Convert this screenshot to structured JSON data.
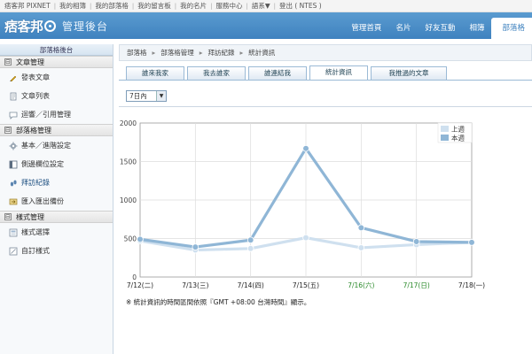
{
  "topbar": {
    "links": [
      "痞客邦 PIXNET",
      "我的相簿",
      "我的部落格",
      "我的留言板",
      "我的名片",
      "服務中心",
      "語系▼",
      "登出 ( NTES )"
    ]
  },
  "header": {
    "logo_text": "痞客邦",
    "subtitle": "管理後台",
    "nav": [
      "管理首頁",
      "名片",
      "好友互動",
      "相簿",
      "部落格"
    ]
  },
  "sidebar": {
    "title": "部落格後台",
    "sections": [
      {
        "toggle": "⊟",
        "label": "文章管理",
        "items": [
          {
            "label": "發表文章",
            "icon": "pencil-icon"
          },
          {
            "label": "文章列表",
            "icon": "document-list-icon"
          },
          {
            "label": "迴響／引用管理",
            "icon": "comment-icon"
          }
        ]
      },
      {
        "toggle": "⊟",
        "label": "部落格管理",
        "items": [
          {
            "label": "基本／進階設定",
            "icon": "gear-icon"
          },
          {
            "label": "側邊欄位設定",
            "icon": "layout-icon"
          },
          {
            "label": "拜訪紀錄",
            "icon": "footprint-icon"
          },
          {
            "label": "匯入匯出備份",
            "icon": "import-export-icon"
          }
        ]
      },
      {
        "toggle": "⊟",
        "label": "樣式管理",
        "items": [
          {
            "label": "樣式選擇",
            "icon": "template-icon"
          },
          {
            "label": "自訂樣式",
            "icon": "custom-style-icon"
          }
        ]
      }
    ]
  },
  "breadcrumb": [
    "部落格",
    "部落格管理",
    "拜訪紀錄",
    "統計資訊"
  ],
  "tabs": [
    "誰來我家",
    "我去誰家",
    "誰連結我",
    "統計資訊",
    "我推過的文章"
  ],
  "filter": {
    "selected": "7日內"
  },
  "chart_data": {
    "type": "line",
    "categories": [
      "7/12(二)",
      "7/13(三)",
      "7/14(四)",
      "7/15(五)",
      "7/16(六)",
      "7/17(日)",
      "7/18(一)"
    ],
    "series": [
      {
        "name": "上週",
        "color": "#cfe0ef",
        "values": [
          470,
          350,
          370,
          510,
          380,
          420,
          450
        ]
      },
      {
        "name": "本週",
        "color": "#8fb6d6",
        "values": [
          490,
          390,
          480,
          1670,
          640,
          460,
          450
        ]
      }
    ],
    "yticks": [
      "0",
      "500",
      "1000",
      "1500",
      "2000"
    ],
    "ylim": [
      0,
      2000
    ],
    "grid": true,
    "legend_position": "top-right",
    "weekend_label_color": "#2a8a2a"
  },
  "footnote": "※ 統計資訊的時間區間依照『GMT +08:00 台灣時間』顯示。"
}
